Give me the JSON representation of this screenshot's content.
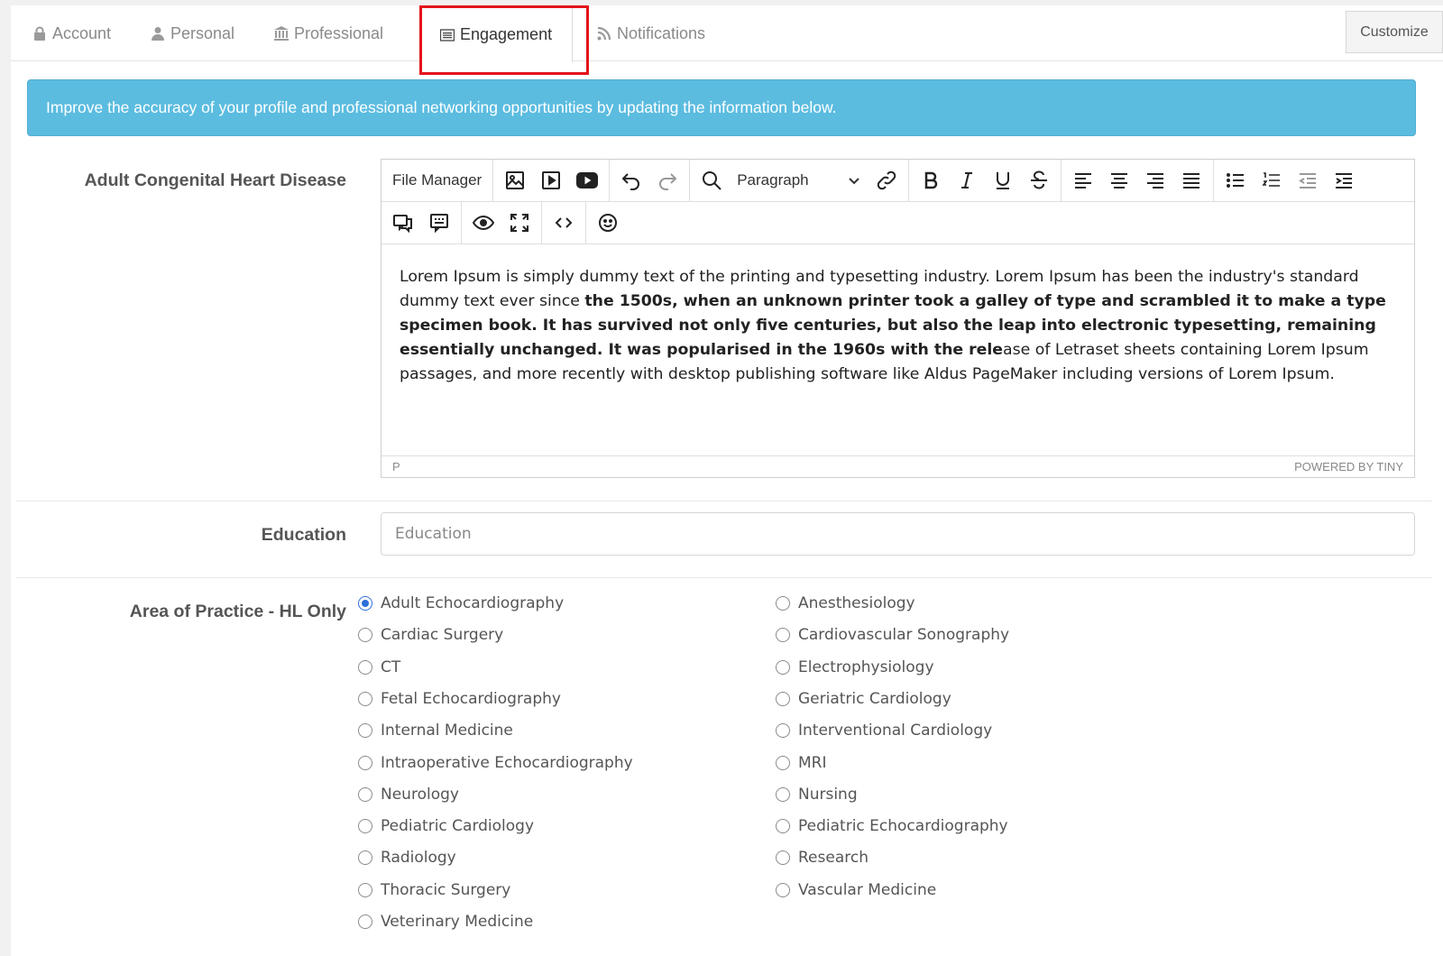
{
  "tabs": [
    {
      "label": "Account",
      "icon": "lock-icon"
    },
    {
      "label": "Personal",
      "icon": "user-icon"
    },
    {
      "label": "Professional",
      "icon": "bank-icon"
    },
    {
      "label": "Engagement",
      "icon": "newspaper-icon",
      "active": true
    },
    {
      "label": "Notifications",
      "icon": "rss-icon"
    }
  ],
  "customize_label": "Customize",
  "alert_text": "Improve the accuracy of your profile and professional networking opportunities by updating the information below.",
  "editor": {
    "field_label": "Adult Congenital Heart Disease",
    "file_manager_label": "File Manager",
    "block_format": "Paragraph",
    "content_part1": "Lorem Ipsum is simply dummy text of the printing and typesetting industry. Lorem Ipsum has been the industry's standard dummy text ever since ",
    "content_bold": "the 1500s, when an unknown printer took a galley of type and scrambled it to make a type specimen book. It has survived not only five centuries, but also the leap into electronic typesetting, remaining essentially unchanged. It was popularised in the 1960s with the rele",
    "content_part2": "ase of Letraset sheets containing Lorem Ipsum passages, and more recently with desktop publishing software like Aldus PageMaker including versions of Lorem Ipsum.",
    "status_path": "P",
    "powered_by": "POWERED BY TINY"
  },
  "education": {
    "label": "Education",
    "placeholder": "Education"
  },
  "area_of_practice": {
    "label": "Area of Practice - HL Only",
    "selected": "Adult Echocardiography",
    "left_options": [
      "Adult Echocardiography",
      "Cardiac Surgery",
      "CT",
      "Fetal Echocardiography",
      "Internal Medicine",
      "Intraoperative Echocardiography",
      "Neurology",
      "Pediatric Cardiology",
      "Radiology",
      "Thoracic Surgery",
      "Veterinary Medicine"
    ],
    "right_options": [
      "Anesthesiology",
      "Cardiovascular Sonography",
      "Electrophysiology",
      "Geriatric Cardiology",
      "Interventional Cardiology",
      "MRI",
      "Nursing",
      "Pediatric Echocardiography",
      "Research",
      "Vascular Medicine"
    ]
  },
  "colors": {
    "alert_bg": "#5bbce0",
    "highlight": "#e3131b",
    "radio_selected": "#2f6fd8"
  }
}
